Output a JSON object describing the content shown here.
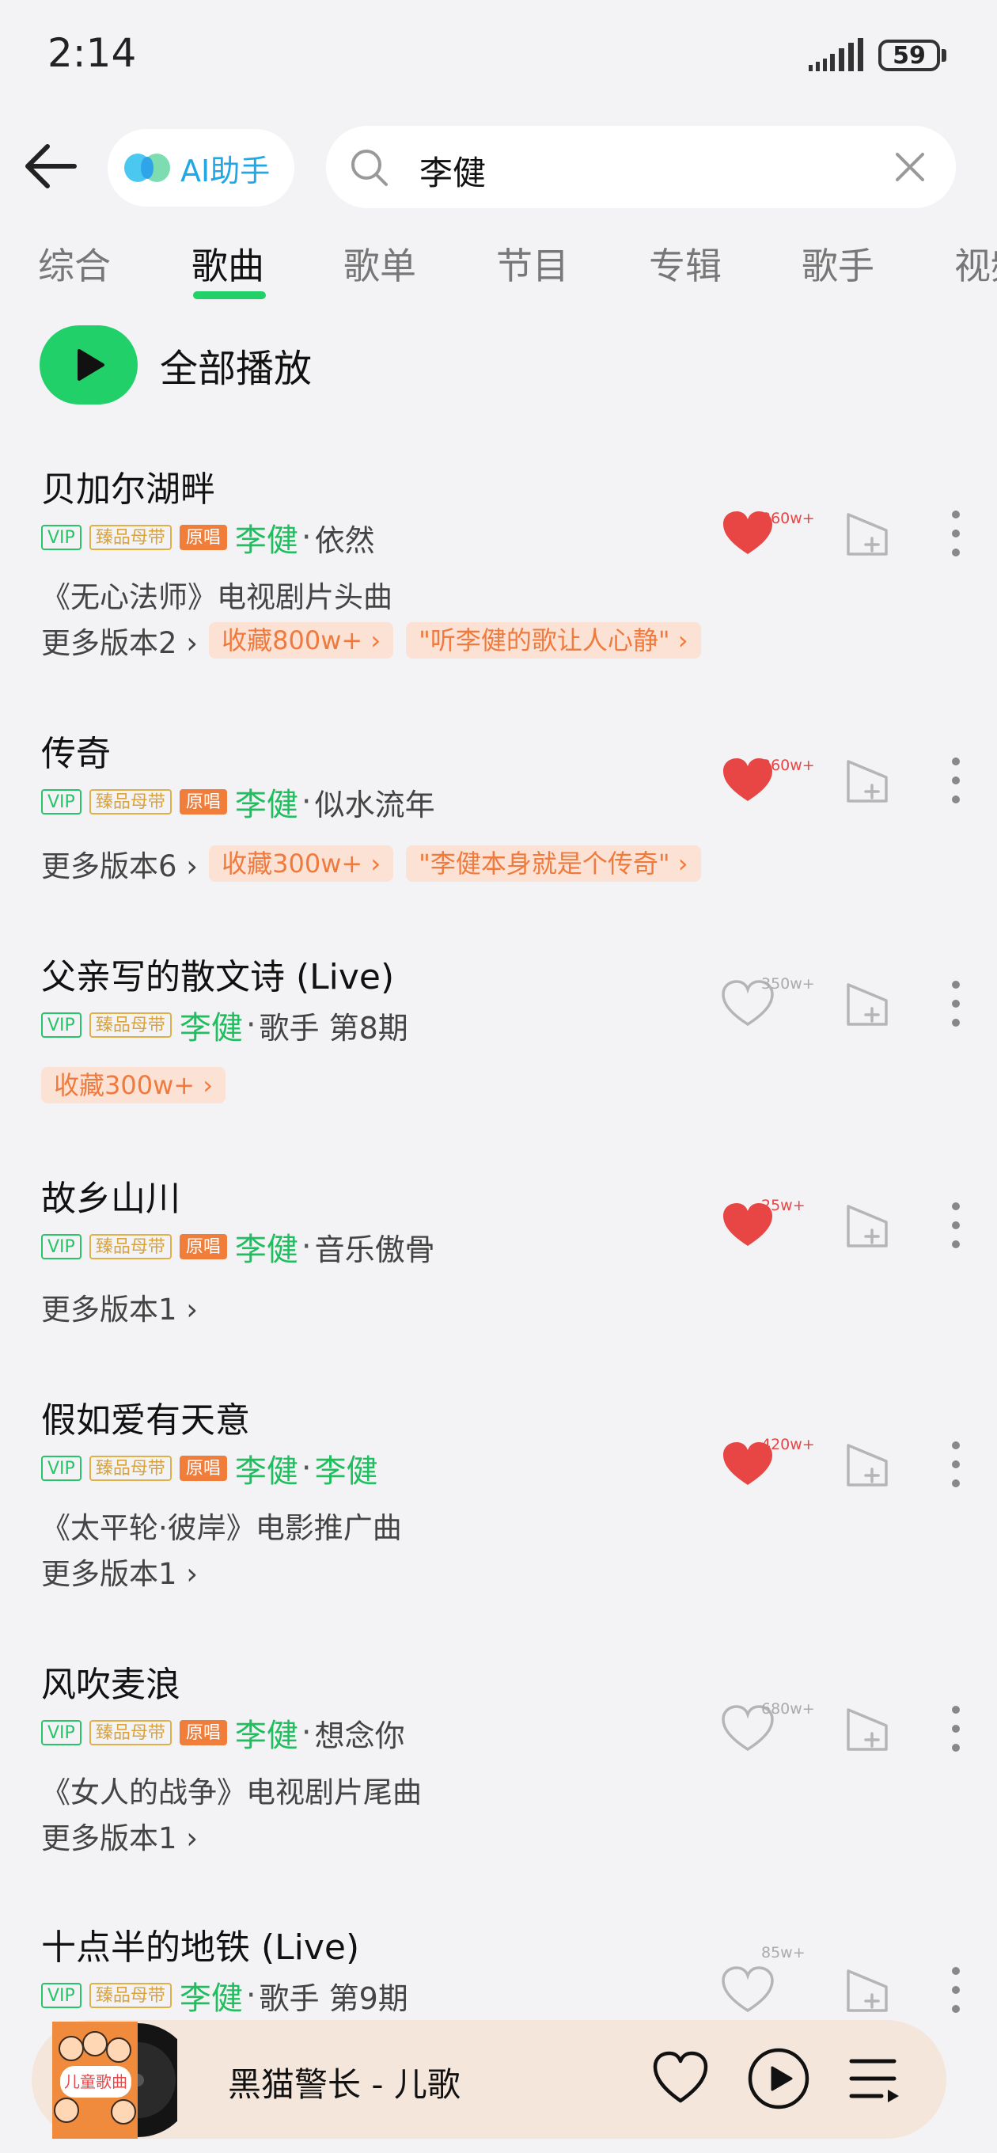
{
  "status": {
    "time": "2:14",
    "battery": "59"
  },
  "search": {
    "ai_label": "AI助手",
    "query": "李健"
  },
  "tabs": [
    "综合",
    "歌曲",
    "歌单",
    "节目",
    "专辑",
    "歌手",
    "视频"
  ],
  "play_all_label": "全部播放",
  "badges": {
    "vip": "VIP",
    "master": "臻品母带",
    "original": "原唱"
  },
  "songs": [
    {
      "title": "贝加尔湖畔",
      "artist": "李健",
      "album": "依然",
      "desc": "《无心法师》电视剧片头曲",
      "more": "更多版本2",
      "chips": [
        "收藏800w+ ›",
        "\"听李健的歌让人心静\" ›"
      ],
      "likes": "860w+",
      "liked": true
    },
    {
      "title": "传奇",
      "artist": "李健",
      "album": "似水流年",
      "more": "更多版本6",
      "chips": [
        "收藏300w+ ›",
        "\"李健本身就是个传奇\" ›"
      ],
      "likes": "360w+",
      "liked": true
    },
    {
      "title": "父亲写的散文诗 (Live)",
      "artist": "李健",
      "album": "歌手 第8期",
      "chips": [
        "收藏300w+ ›"
      ],
      "likes": "350w+",
      "liked": false
    },
    {
      "title": "故乡山川",
      "artist": "李健",
      "album": "音乐傲骨",
      "more": "更多版本1",
      "likes": "25w+",
      "liked": true
    },
    {
      "title": "假如爱有天意",
      "artist": "李健",
      "album": "李健",
      "desc": "《太平轮·彼岸》电影推广曲",
      "more": "更多版本1",
      "likes": "420w+",
      "liked": true
    },
    {
      "title": "风吹麦浪",
      "artist": "李健",
      "album": "想念你",
      "desc": "《女人的战争》电视剧片尾曲",
      "more": "更多版本1",
      "likes": "680w+",
      "liked": false
    },
    {
      "title": "十点半的地铁 (Live)",
      "artist": "李健",
      "album": "歌手 第9期",
      "likes": "85w+",
      "liked": false
    }
  ],
  "player": {
    "now_playing": "黑猫警长 - 儿歌",
    "cover_text": "儿童歌曲"
  },
  "colors": {
    "accent": "#22d06a",
    "heart": "#e84545",
    "chip_bg": "#fbe2d5",
    "chip_text": "#f07a3d"
  }
}
